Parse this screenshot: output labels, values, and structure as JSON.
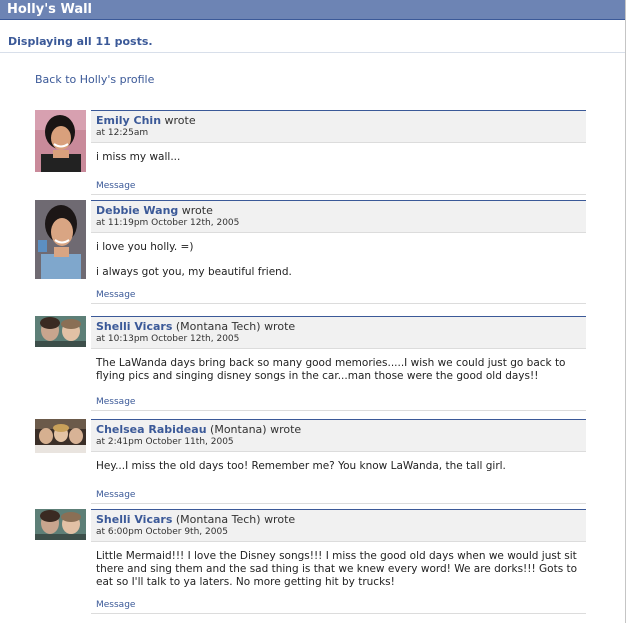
{
  "page": {
    "title": "Holly's Wall",
    "subtitle": "Displaying all 11 posts.",
    "back_link": "Back to Holly's profile"
  },
  "posts": [
    {
      "author": "Emily Chin",
      "network": "",
      "wrote": "wrote",
      "time": "at 12:25am",
      "paragraphs": [
        "i miss my wall..."
      ],
      "action": "Message"
    },
    {
      "author": "Debbie Wang",
      "network": "",
      "wrote": "wrote",
      "time": "at 11:19pm October 12th, 2005",
      "paragraphs": [
        "i love you holly. =)",
        "i always got you, my beautiful friend."
      ],
      "action": "Message"
    },
    {
      "author": "Shelli Vicars",
      "network": "(Montana Tech)",
      "wrote": "wrote",
      "time": "at 10:13pm October 12th, 2005",
      "paragraphs": [
        "The LaWanda days bring back so many good memories.....I wish we could just go back to flying pics and singing disney songs in the car...man those were the good old days!!"
      ],
      "action": "Message"
    },
    {
      "author": "Chelsea Rabideau",
      "network": "(Montana)",
      "wrote": "wrote",
      "time": "at 2:41pm October 11th, 2005",
      "paragraphs": [
        "Hey...I miss the old days too! Remember me? You know LaWanda, the tall girl."
      ],
      "action": "Message"
    },
    {
      "author": "Shelli Vicars",
      "network": "(Montana Tech)",
      "wrote": "wrote",
      "time": "at 6:00pm October 9th, 2005",
      "paragraphs": [
        "Little Mermaid!!! I love the Disney songs!!! I miss the good old days when we would just sit there and sing them and the sad thing is that we knew every word! We are dorks!!! Gots to eat so I'll talk to ya laters. No more getting hit by trucks!"
      ],
      "action": "Message"
    }
  ]
}
